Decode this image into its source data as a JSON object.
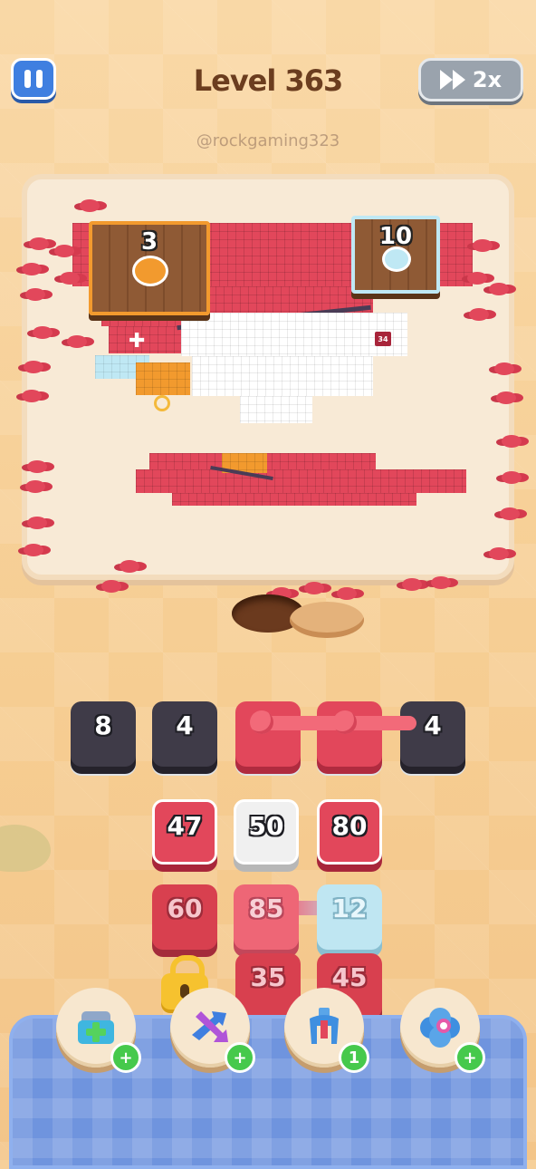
{
  "header": {
    "title": "Level 363",
    "speed_label": "2x",
    "watermark": "@rockgaming323"
  },
  "board": {
    "crates": [
      {
        "count": "3",
        "color": "#f29a2e"
      },
      {
        "count": "10",
        "color": "#bfe8f4"
      }
    ],
    "pixel_badge": "34"
  },
  "queue_slots": [
    {
      "value": "8",
      "kind": "dark"
    },
    {
      "value": "4",
      "kind": "dark"
    },
    {
      "value": "",
      "kind": "red-linked"
    },
    {
      "value": "",
      "kind": "red-linked"
    },
    {
      "value": "4",
      "kind": "dark"
    }
  ],
  "grid_tiles": {
    "row1": [
      "47",
      "50",
      "80"
    ],
    "row2": [
      "60",
      "85",
      "12"
    ],
    "row3": [
      "35",
      "45"
    ]
  },
  "powerups": [
    {
      "name": "add-slot",
      "badge": "+"
    },
    {
      "name": "shuffle",
      "badge": "+"
    },
    {
      "name": "magnet-claw",
      "badge": "1"
    },
    {
      "name": "swap",
      "badge": "+"
    }
  ],
  "colors": {
    "red": "#e2475b",
    "cyan": "#bfe6f2",
    "orange": "#f29a2e",
    "dark_slot": "#3f3b48",
    "tray_blue": "#6f94de"
  }
}
